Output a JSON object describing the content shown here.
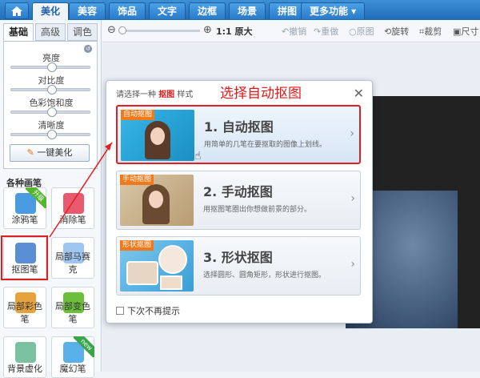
{
  "topbar": {
    "tabs": [
      "美化",
      "美容",
      "饰品",
      "文字",
      "边框",
      "场景",
      "拼图",
      "更多功能 ▾"
    ],
    "active_tab": "美化"
  },
  "left": {
    "subtabs": [
      "基础",
      "高级",
      "调色"
    ],
    "sliders": [
      {
        "label": "亮度",
        "level": 0.5
      },
      {
        "label": "对比度",
        "level": 0.5
      },
      {
        "label": "色彩饱和度",
        "level": 0.5
      },
      {
        "label": "清晰度",
        "level": 0.5
      }
    ],
    "oneclick_label": "一键美化",
    "brush_section_title": "各种画笔",
    "brushes": [
      {
        "label": "涂鸦笔",
        "badge": "升级",
        "color": "#4b9be0"
      },
      {
        "label": "消除笔",
        "badge": "",
        "color": "#e85a6e"
      },
      {
        "label": "抠图笔",
        "badge": "",
        "color": "#5a8fd6"
      },
      {
        "label": "局部马赛克",
        "badge": "",
        "color": "#9ec6f0"
      },
      {
        "label": "局部彩色笔",
        "badge": "",
        "color": "#e6a23c"
      },
      {
        "label": "局部变色笔",
        "badge": "",
        "color": "#6cbf3a"
      },
      {
        "label": "背景虚化",
        "badge": "",
        "color": "#7bc0a0"
      },
      {
        "label": "魔幻笔",
        "badge": "new",
        "color": "#5ab0e8"
      }
    ]
  },
  "toolbar": {
    "zoom_label": "1:1 原大",
    "undo": "撤销",
    "redo": "重做",
    "original": "原图",
    "rotate": "旋转",
    "crop": "裁剪",
    "size": "尺寸"
  },
  "dialog": {
    "hint_prefix": "请选择一种",
    "hint_keyword": "抠图",
    "hint_suffix": "样式",
    "annotation": "选择自动抠图",
    "options": [
      {
        "tag": "自动抠图",
        "title": "1. 自动抠图",
        "desc": "用简单的几笔在要抠取的图像上划线。",
        "selected": true
      },
      {
        "tag": "手动抠图",
        "title": "2. 手动抠图",
        "desc": "用抠图笔圈出你想做前景的部分。",
        "selected": false
      },
      {
        "tag": "形状抠图",
        "title": "3. 形状抠图",
        "desc": "选择圆形、圆角矩形，形状进行抠图。",
        "selected": false
      }
    ],
    "no_show_label": "下次不再提示"
  },
  "colors": {
    "accent_blue": "#1f6db8",
    "annotation_red": "#e02020"
  }
}
